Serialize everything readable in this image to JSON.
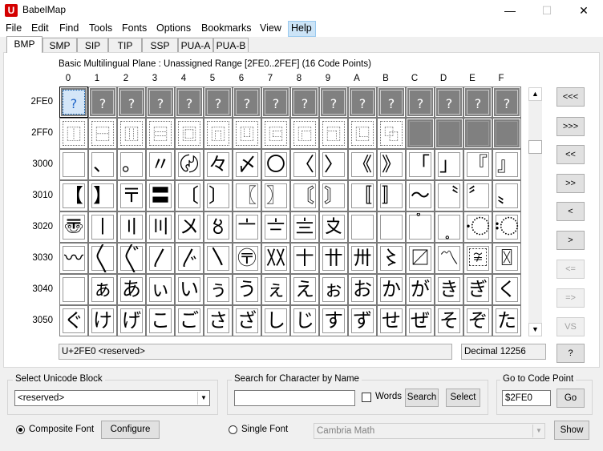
{
  "window": {
    "title": "BabelMap",
    "app_icon": "U",
    "minimize": "—",
    "maximize": "☐",
    "close": "✕"
  },
  "menu": [
    "File",
    "Edit",
    "Find",
    "Tools",
    "Fonts",
    "Options",
    "Bookmarks",
    "View",
    "Help"
  ],
  "tabs": [
    "BMP",
    "SMP",
    "SIP",
    "TIP",
    "SSP",
    "PUA-A",
    "PUA-B"
  ],
  "plane_heading": "Basic Multilingual Plane : Unassigned Range [2FE0..2FEF] (16 Code Points)",
  "col_headers": [
    "0",
    "1",
    "2",
    "3",
    "4",
    "5",
    "6",
    "7",
    "8",
    "9",
    "A",
    "B",
    "C",
    "D",
    "E",
    "F"
  ],
  "rows": [
    {
      "label": "2FE0",
      "type": "unassigned",
      "cells": [
        "?",
        "?",
        "?",
        "?",
        "?",
        "?",
        "?",
        "?",
        "?",
        "?",
        "?",
        "?",
        "?",
        "?",
        "?",
        "?"
      ]
    },
    {
      "label": "2FF0",
      "type": "ids",
      "cells": [
        "⿰",
        "⿱",
        "⿲",
        "⿳",
        "⿴",
        "⿵",
        "⿶",
        "⿷",
        "⿸",
        "⿹",
        "⿺",
        "⿻",
        "",
        "",
        "",
        ""
      ]
    },
    {
      "label": "3000",
      "type": "normal",
      "cells": [
        "",
        "、",
        "。",
        "〃",
        "〄",
        "々",
        "〆",
        "〇",
        "〈",
        "〉",
        "《",
        "》",
        "「",
        "」",
        "『",
        "』"
      ]
    },
    {
      "label": "3010",
      "type": "normal",
      "cells": [
        "【",
        "】",
        "〒",
        "〓",
        "〔",
        "〕",
        "〖",
        "〗",
        "〘",
        "〙",
        "〚",
        "〛",
        "〜",
        "〝",
        "〞",
        "〟"
      ]
    },
    {
      "label": "3020",
      "type": "normal",
      "cells": [
        "〠",
        "〡",
        "〢",
        "〣",
        "〤",
        "〥",
        "〦",
        "〧",
        "〨",
        "〩",
        "〪",
        "〫",
        "〬",
        "〭",
        "〮",
        "〯"
      ]
    },
    {
      "label": "3030",
      "type": "normal",
      "cells": [
        "〰",
        "〱",
        "〲",
        "〳",
        "〴",
        "〵",
        "〶",
        "〷",
        "〸",
        "〹",
        "〺",
        "〻",
        "〼",
        "〽",
        "〾",
        "〿"
      ]
    },
    {
      "label": "3040",
      "type": "normal",
      "cells": [
        "",
        "ぁ",
        "あ",
        "ぃ",
        "い",
        "ぅ",
        "う",
        "ぇ",
        "え",
        "ぉ",
        "お",
        "か",
        "が",
        "き",
        "ぎ",
        "く"
      ]
    },
    {
      "label": "3050",
      "type": "normal",
      "cells": [
        "ぐ",
        "け",
        "げ",
        "こ",
        "ご",
        "さ",
        "ざ",
        "し",
        "じ",
        "す",
        "ず",
        "せ",
        "ぜ",
        "そ",
        "ぞ",
        "た"
      ]
    }
  ],
  "nav_buttons": [
    {
      "label": "<<<",
      "enabled": true
    },
    {
      "label": ">>>",
      "enabled": true
    },
    {
      "label": "<<",
      "enabled": true
    },
    {
      "label": ">>",
      "enabled": true
    },
    {
      "label": "<",
      "enabled": true
    },
    {
      "label": ">",
      "enabled": true
    },
    {
      "label": "<=",
      "enabled": false
    },
    {
      "label": "=>",
      "enabled": false
    },
    {
      "label": "VS",
      "enabled": false
    },
    {
      "label": "?",
      "enabled": true
    }
  ],
  "status": {
    "char_info": "U+2FE0 <reserved>",
    "decimal": "Decimal 12256"
  },
  "block_group": {
    "label": "Select Unicode Block",
    "value": "<reserved>"
  },
  "search_group": {
    "label": "Search for Character by Name",
    "query": "",
    "words_label": "Words",
    "words_checked": false,
    "search_button": "Search",
    "select_button": "Select"
  },
  "goto_group": {
    "label": "Go to Code Point",
    "value": "$2FE0",
    "go_button": "Go"
  },
  "font_options": {
    "composite_label": "Composite Font",
    "composite_selected": true,
    "configure_button": "Configure",
    "single_label": "Single Font",
    "single_selected": false,
    "single_font_value": "Cambria Math",
    "show_button": "Show"
  }
}
